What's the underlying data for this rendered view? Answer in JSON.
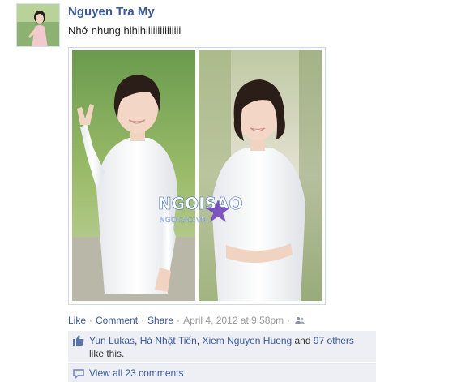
{
  "post": {
    "author": "Nguyen Tra My",
    "message": "Nhớ nhung hihihiiiiiiiiiiiiiii",
    "watermark_logo": "NGOISAO",
    "watermark_url": "NGOISAO.VN"
  },
  "actions": {
    "like": "Like",
    "comment": "Comment",
    "share": "Share",
    "separator": "·",
    "timestamp": "April 4, 2012 at 9:58pm",
    "privacy_icon": "friends-icon"
  },
  "likes": {
    "icon": "thumbs-up-icon",
    "person1": "Yun Lukas",
    "sep1": ", ",
    "person2": "Hà Nhật Tiến",
    "sep2": ", ",
    "person3": "Xiem Nguyen Huong",
    "and": " and ",
    "others": "97 others",
    "suffix": "like this."
  },
  "comments": {
    "icon": "comment-bubble-icon",
    "view_all": "View all 23 comments"
  },
  "colors": {
    "link": "#3b5998",
    "panel": "#edeff4",
    "muted": "#999999"
  }
}
